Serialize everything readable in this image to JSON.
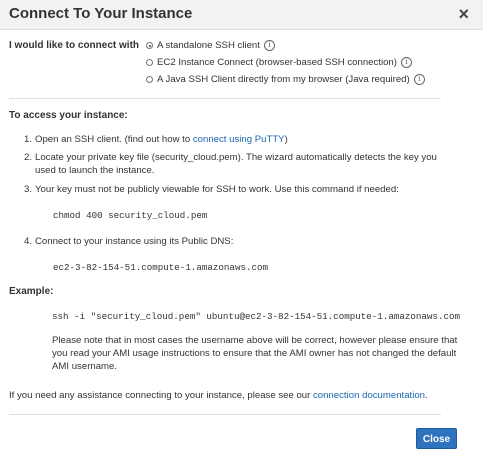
{
  "dialog": {
    "title": "Connect To Your Instance",
    "close_symbol": "×"
  },
  "connect_options": {
    "label": "I would like to connect with",
    "options": [
      {
        "label": "A standalone SSH client",
        "selected": true
      },
      {
        "label": "EC2 Instance Connect (browser-based SSH connection)",
        "selected": false
      },
      {
        "label": "A Java SSH Client directly from my browser (Java required)",
        "selected": false
      }
    ]
  },
  "access": {
    "heading": "To access your instance:",
    "step1": {
      "num": "1.",
      "text_before": "Open an SSH client. (find out how to ",
      "link": "connect using PuTTY",
      "text_after": ")"
    },
    "step2": {
      "num": "2.",
      "line1": "Locate your private key file (security_cloud.pem). The wizard automatically detects the key you",
      "line2": "used to launch the instance."
    },
    "step3": {
      "num": "3.",
      "text": "Your key must not be publicly viewable for SSH to work. Use this command if needed:"
    },
    "chmod_command": "chmod 400 security_cloud.pem",
    "step4": {
      "num": "4.",
      "text": "Connect to your instance using its Public DNS:"
    },
    "public_dns": "ec2-3-82-154-51.compute-1.amazonaws.com"
  },
  "example": {
    "heading": "Example:",
    "command": "ssh -i \"security_cloud.pem\" ubuntu@ec2-3-82-154-51.compute-1.amazonaws.com",
    "note": "Please note that in most cases the username above will be correct, however please ensure that you read your AMI usage instructions to ensure that the AMI owner has not changed the default AMI username."
  },
  "assistance": {
    "text_before": "If you need any assistance connecting to your instance, please see our ",
    "link": "connection documentation",
    "text_after": "."
  },
  "footer": {
    "close_label": "Close"
  },
  "colors": {
    "link": "#1a66b3",
    "primary_button": "#2f73be",
    "header_bg": "#f2f2f2"
  }
}
